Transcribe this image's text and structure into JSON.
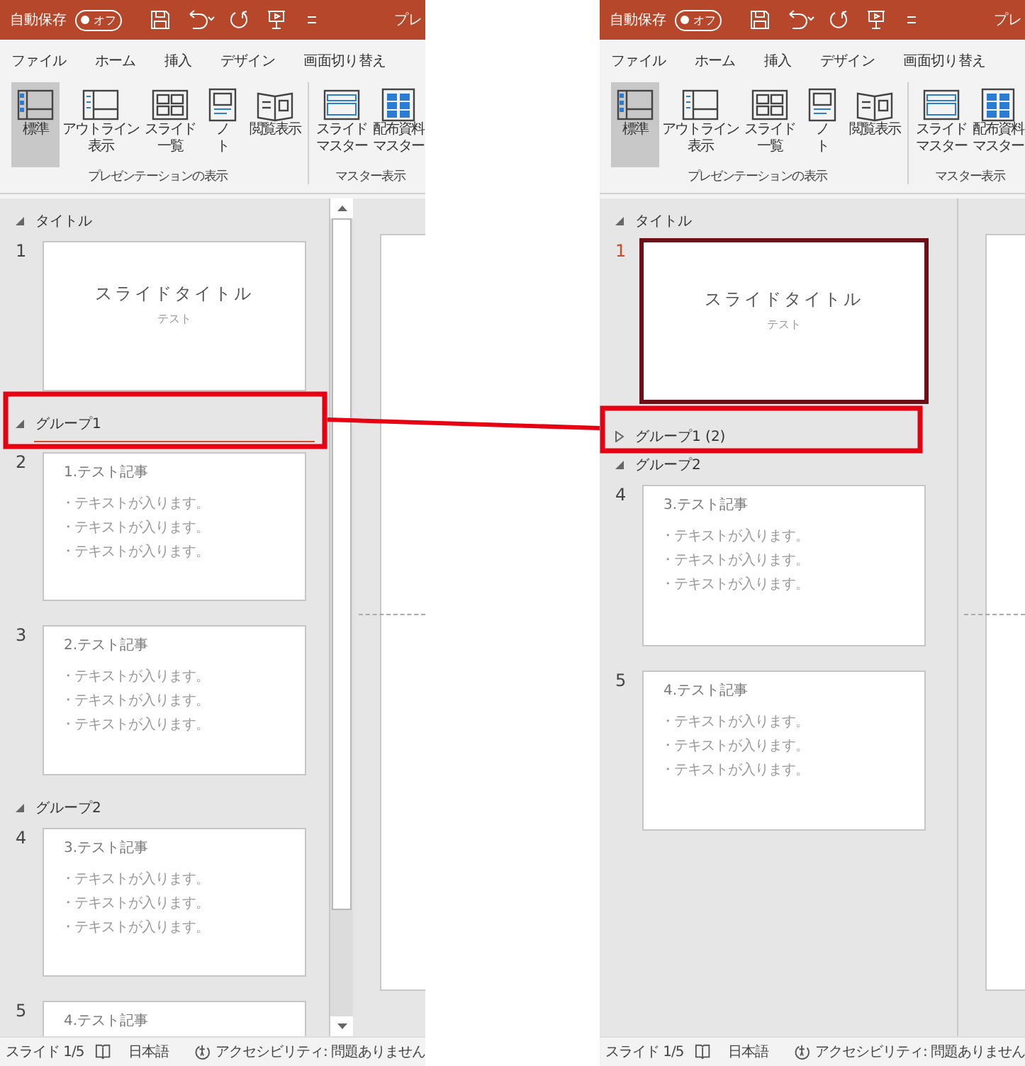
{
  "panes": [
    {
      "title_bar": {
        "autosave_label": "自動保存",
        "autosave_toggle": {
          "label": "オフ",
          "on": false
        },
        "title": "プレ"
      },
      "tabs": [
        "ファイル",
        "ホーム",
        "挿入",
        "デザイン",
        "画面切り替え"
      ],
      "ribbon": {
        "groups": [
          {
            "label": "プレゼンテーションの表示",
            "buttons": [
              {
                "kind": "normal",
                "lines": [
                  "標準"
                ],
                "selected": true
              },
              {
                "kind": "outline",
                "lines": [
                  "アウトライン",
                  "表示"
                ],
                "selected": false
              },
              {
                "kind": "sorter",
                "lines": [
                  "スライド",
                  "一覧"
                ],
                "selected": false
              },
              {
                "kind": "notes",
                "lines": [
                  "ノ",
                  "ト"
                ],
                "selected": false
              },
              {
                "kind": "reading",
                "lines": [
                  "閲覧表示"
                ],
                "selected": false
              }
            ]
          },
          {
            "label": "マスター表示",
            "buttons": [
              {
                "kind": "slide_master",
                "lines": [
                  "スライド",
                  "マスター"
                ],
                "selected": false
              },
              {
                "kind": "handout_master",
                "lines": [
                  "配布資料",
                  "マスター"
                ],
                "selected": false
              }
            ]
          }
        ]
      },
      "slide_panel": {
        "scrollbar": true,
        "items": [
          {
            "kind": "section",
            "label": "タイトル",
            "expanded": true,
            "drop_indicator": false
          },
          {
            "kind": "title_slide",
            "number": "1",
            "title": "スライドタイトル",
            "subtitle": "テスト",
            "selected": false
          },
          {
            "kind": "section",
            "label": "グループ1",
            "expanded": true,
            "drop_indicator": true
          },
          {
            "kind": "content_slide",
            "number": "2",
            "title": "1.テスト記事",
            "bullets": [
              "・テキストが入ります。",
              "・テキストが入ります。",
              "・テキストが入ります。"
            ],
            "selected": false
          },
          {
            "kind": "content_slide",
            "number": "3",
            "title": "2.テスト記事",
            "bullets": [
              "・テキストが入ります。",
              "・テキストが入ります。",
              "・テキストが入ります。"
            ],
            "selected": false
          },
          {
            "kind": "section",
            "label": "グループ2",
            "expanded": true,
            "drop_indicator": false
          },
          {
            "kind": "content_slide",
            "number": "4",
            "title": "3.テスト記事",
            "bullets": [
              "・テキストが入ります。",
              "・テキストが入ります。",
              "・テキストが入ります。"
            ],
            "selected": false
          },
          {
            "kind": "content_slide",
            "number": "5",
            "title": "4.テスト記事",
            "selected": false
          }
        ]
      },
      "status_bar": {
        "slide": "スライド 1/5",
        "language": "日本語",
        "accessibility": "アクセシビリティ: 問題ありません"
      }
    },
    {
      "title_bar": {
        "autosave_label": "自動保存",
        "autosave_toggle": {
          "label": "オフ",
          "on": false
        },
        "title": "プレ"
      },
      "tabs": [
        "ファイル",
        "ホーム",
        "挿入",
        "デザイン",
        "画面切り替え"
      ],
      "ribbon": {
        "groups": [
          {
            "label": "プレゼンテーションの表示",
            "buttons": [
              {
                "kind": "normal",
                "lines": [
                  "標準"
                ],
                "selected": true
              },
              {
                "kind": "outline",
                "lines": [
                  "アウトライン",
                  "表示"
                ],
                "selected": false
              },
              {
                "kind": "sorter",
                "lines": [
                  "スライド",
                  "一覧"
                ],
                "selected": false
              },
              {
                "kind": "notes",
                "lines": [
                  "ノ",
                  "ト"
                ],
                "selected": false
              },
              {
                "kind": "reading",
                "lines": [
                  "閲覧表示"
                ],
                "selected": false
              }
            ]
          },
          {
            "label": "マスター表示",
            "buttons": [
              {
                "kind": "slide_master",
                "lines": [
                  "スライド",
                  "マスター"
                ],
                "selected": false
              },
              {
                "kind": "handout_master",
                "lines": [
                  "配布資料",
                  "マスター"
                ],
                "selected": false
              }
            ]
          }
        ]
      },
      "slide_panel": {
        "scrollbar": false,
        "items": [
          {
            "kind": "section",
            "label": "タイトル",
            "expanded": true,
            "drop_indicator": false
          },
          {
            "kind": "title_slide",
            "number": "1",
            "title": "スライドタイトル",
            "subtitle": "テスト",
            "selected": true
          },
          {
            "kind": "section",
            "label": "グループ1 (2)",
            "expanded": false,
            "drop_indicator": false
          },
          {
            "kind": "section",
            "label": "グループ2",
            "expanded": true,
            "drop_indicator": false
          },
          {
            "kind": "content_slide",
            "number": "4",
            "title": "3.テスト記事",
            "bullets": [
              "・テキストが入ります。",
              "・テキストが入ります。",
              "・テキストが入ります。"
            ],
            "selected": false
          },
          {
            "kind": "content_slide",
            "number": "5",
            "title": "4.テスト記事",
            "bullets": [
              "・テキストが入ります。",
              "・テキストが入ります。",
              "・テキストが入ります。"
            ],
            "selected": false
          }
        ]
      },
      "status_bar": {
        "slide": "スライド 1/5",
        "language": "日本語",
        "accessibility": "アクセシビリティ: 問題ありません"
      }
    }
  ]
}
